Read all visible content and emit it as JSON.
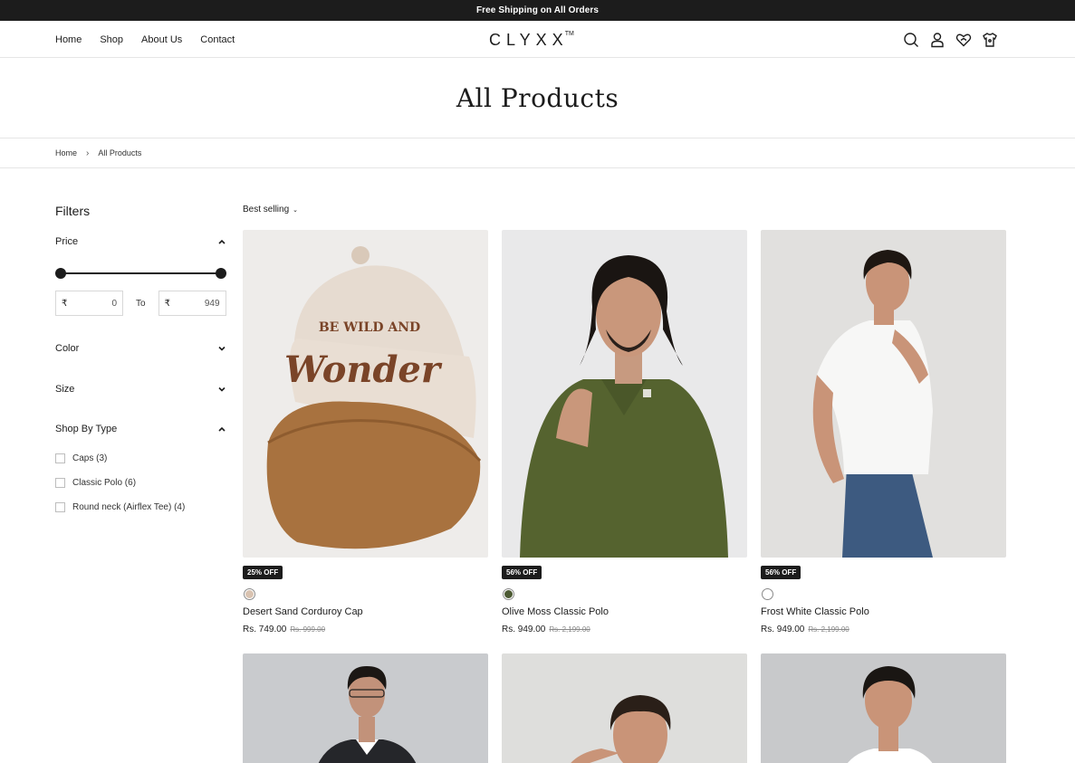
{
  "announcement": "Free Shipping on All Orders",
  "nav": {
    "home": "Home",
    "shop": "Shop",
    "about": "About Us",
    "contact": "Contact"
  },
  "logo": {
    "text": "CLYXX",
    "mark": "TM"
  },
  "header_icons": [
    "search-icon",
    "account-icon",
    "wishlist-icon",
    "cart-icon"
  ],
  "page_title": "All Products",
  "breadcrumb": {
    "home": "Home",
    "sep": "›",
    "current": "All Products"
  },
  "filters": {
    "title": "Filters",
    "price": {
      "label": "Price",
      "currency": "₹",
      "min": "0",
      "to": "To",
      "max": "949"
    },
    "color": "Color",
    "size": "Size",
    "type": {
      "label": "Shop By Type",
      "options": [
        "Caps (3)",
        "Classic Polo (6)",
        "Round neck (Airflex Tee) (4)"
      ]
    }
  },
  "sort": {
    "label": "Best selling",
    "caret": "⌄"
  },
  "products": [
    {
      "badge": "25% OFF",
      "name": "Desert Sand Corduroy Cap",
      "price": "Rs. 749.00",
      "old_price": "Rs. 999.00",
      "swatch": "#d9c3b1"
    },
    {
      "badge": "56% OFF",
      "name": "Olive Moss Classic Polo",
      "price": "Rs. 949.00",
      "old_price": "Rs. 2,199.00",
      "swatch": "#4c5a33"
    },
    {
      "badge": "56% OFF",
      "name": "Frost White Classic Polo",
      "price": "Rs. 949.00",
      "old_price": "Rs. 2,199.00",
      "swatch": "#ffffff"
    }
  ],
  "cap_text": {
    "line1": "BE WILD AND",
    "line2": "Wonder"
  },
  "colors": {
    "topbar": "#1c1c1c",
    "accent": "#1c1c1c",
    "border": "#e6e6e6"
  }
}
